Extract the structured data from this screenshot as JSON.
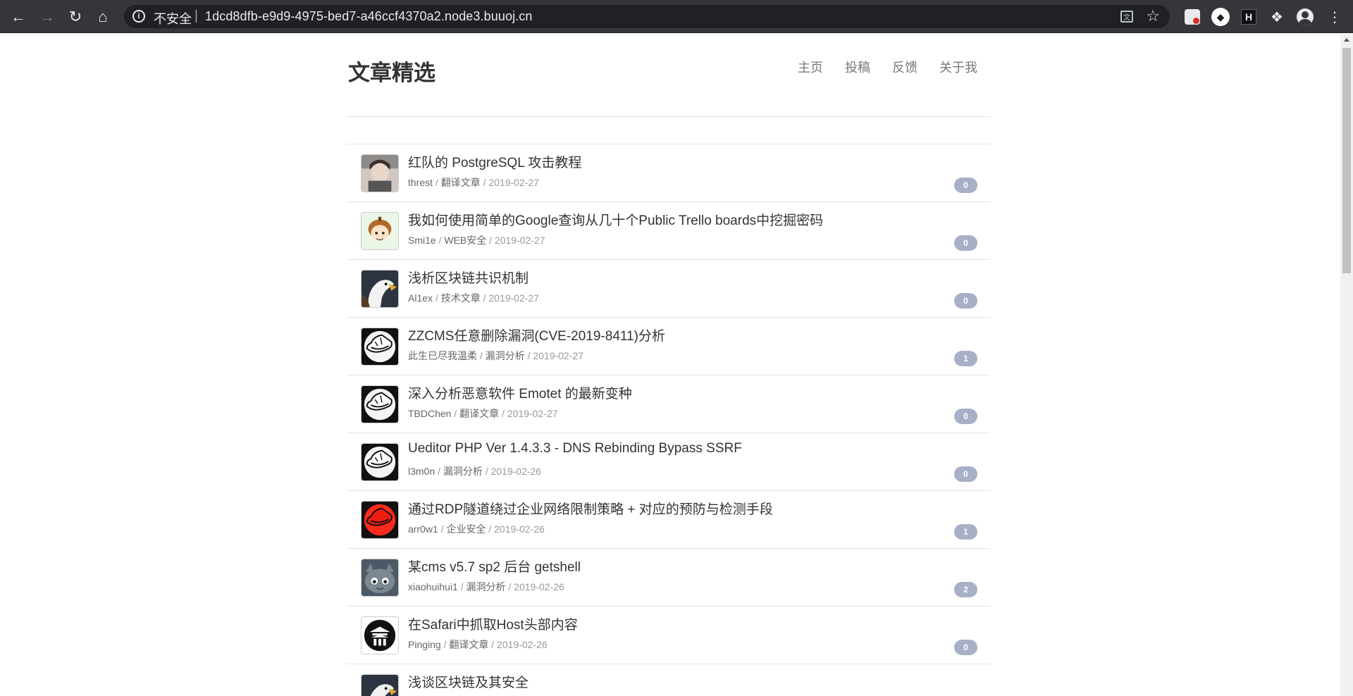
{
  "browser": {
    "insecure_label": "不安全",
    "separator": "|",
    "url": "1dcd8dfb-e9d9-4975-bed7-a46ccf4370a2.node3.buuoj.cn"
  },
  "site": {
    "title": "文章精选",
    "nav": [
      "主页",
      "投稿",
      "反馈",
      "关于我"
    ]
  },
  "articles": [
    {
      "title": "红队的 PostgreSQL 攻击教程",
      "author": "threst",
      "category": "翻译文章",
      "date": "2019-02-27",
      "comments": "0",
      "avatar": "photo-person"
    },
    {
      "title": "我如何使用简单的Google查询从几十个Public Trello boards中挖掘密码",
      "author": "Smi1e",
      "category": "WEB安全",
      "date": "2019-02-27",
      "comments": "0",
      "avatar": "cartoon-boy"
    },
    {
      "title": "浅析区块链共识机制",
      "author": "Al1ex",
      "category": "技术文章",
      "date": "2019-02-27",
      "comments": "0",
      "avatar": "eagle"
    },
    {
      "title": "ZZCMS任意删除漏洞(CVE-2019-8411)分析",
      "author": "此生已尽我温柔",
      "category": "漏洞分析",
      "date": "2019-02-27",
      "comments": "1",
      "avatar": "white-hat"
    },
    {
      "title": "深入分析恶意软件 Emotet 的最新变种",
      "author": "TBDChen",
      "category": "翻译文章",
      "date": "2019-02-27",
      "comments": "0",
      "avatar": "white-hat"
    },
    {
      "title": "Ueditor PHP Ver 1.4.3.3 - DNS Rebinding Bypass SSRF",
      "author": "l3m0n",
      "category": "漏洞分析",
      "date": "2019-02-26",
      "comments": "0",
      "avatar": "white-hat"
    },
    {
      "title": "通过RDP隧道绕过企业网络限制策略 + 对应的预防与检测手段",
      "author": "arr0w1",
      "category": "企业安全",
      "date": "2019-02-26",
      "comments": "1",
      "avatar": "red-hat"
    },
    {
      "title": "某cms v5.7 sp2 后台 getshell",
      "author": "xiaohuihui1",
      "category": "漏洞分析",
      "date": "2019-02-26",
      "comments": "2",
      "avatar": "gray-monster"
    },
    {
      "title": "在Safari中抓取Host头部内容",
      "author": "Pinging",
      "category": "翻译文章",
      "date": "2019-02-26",
      "comments": "0",
      "avatar": "pagoda-logo"
    },
    {
      "title": "浅谈区块链及其安全",
      "author": "",
      "category": "",
      "date": "",
      "comments": "",
      "avatar": "eagle"
    }
  ]
}
